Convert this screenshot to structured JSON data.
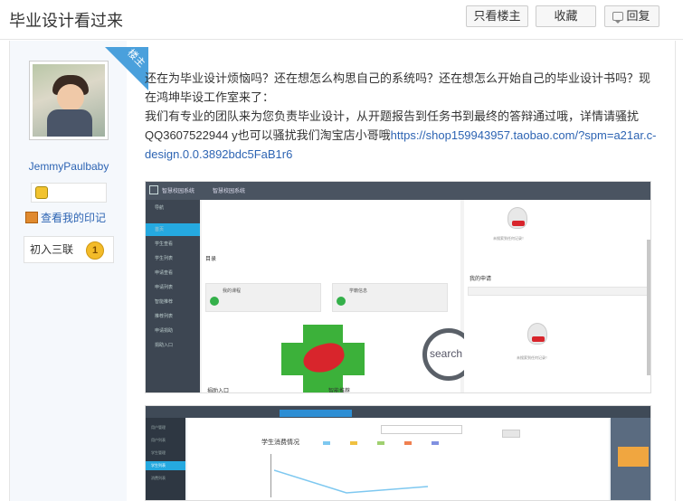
{
  "header": {
    "title": "毕业设计看过来",
    "only_op_label": "只看楼主",
    "favorite_label": "收藏",
    "reply_label": "回复"
  },
  "author": {
    "username": "JemmyPaulbaby",
    "footprint_label": "查看我的印记",
    "badge_text": "初入三联",
    "badge_level": "1",
    "ribbon_label": "楼主"
  },
  "post": {
    "paragraph1": "还在为毕业设计烦恼吗？还在想怎么构思自己的系统吗？还在想怎么开始自己的毕业设计书吗？现在鸿坤毕设工作室来了：",
    "paragraph2_text": "我们有专业的团队来为您负责毕业设计，从开题报告到任务书到最终的答辩通过哦，详情请骚扰QQ3607522944 y也可以骚扰我们淘宝店小哥哦",
    "link": "https://shop159943957.taobao.com/?spm=a21ar.c-design.0.0.3892bdc5FaB1r6"
  },
  "shot1": {
    "brand": "智慧校园系统",
    "section_label": "目录",
    "search_label": "search",
    "card1": "我的课程",
    "card2": "学籍信息",
    "bottom_left": "捐助入口",
    "bottom_right": "智能推荐",
    "right_title": "我的申请",
    "empty_tip": "未搜索到任何记录！",
    "sidebar_items": [
      "导航",
      "首页",
      "学生查看",
      "学生列表",
      "申请查看",
      "申请列表",
      "智能推荐",
      "推荐列表",
      "申请捐助",
      "捐助入口"
    ]
  },
  "shot2": {
    "chart_title": "学生消费情况",
    "sidebar_items": [
      "用户管理",
      "用户列表",
      "学生管理",
      "学生列表",
      "消费列表"
    ]
  },
  "colors": {
    "link": "#2d64b3",
    "ribbon": "#4aa0dc",
    "sidebar_active": "#25a9e0"
  }
}
